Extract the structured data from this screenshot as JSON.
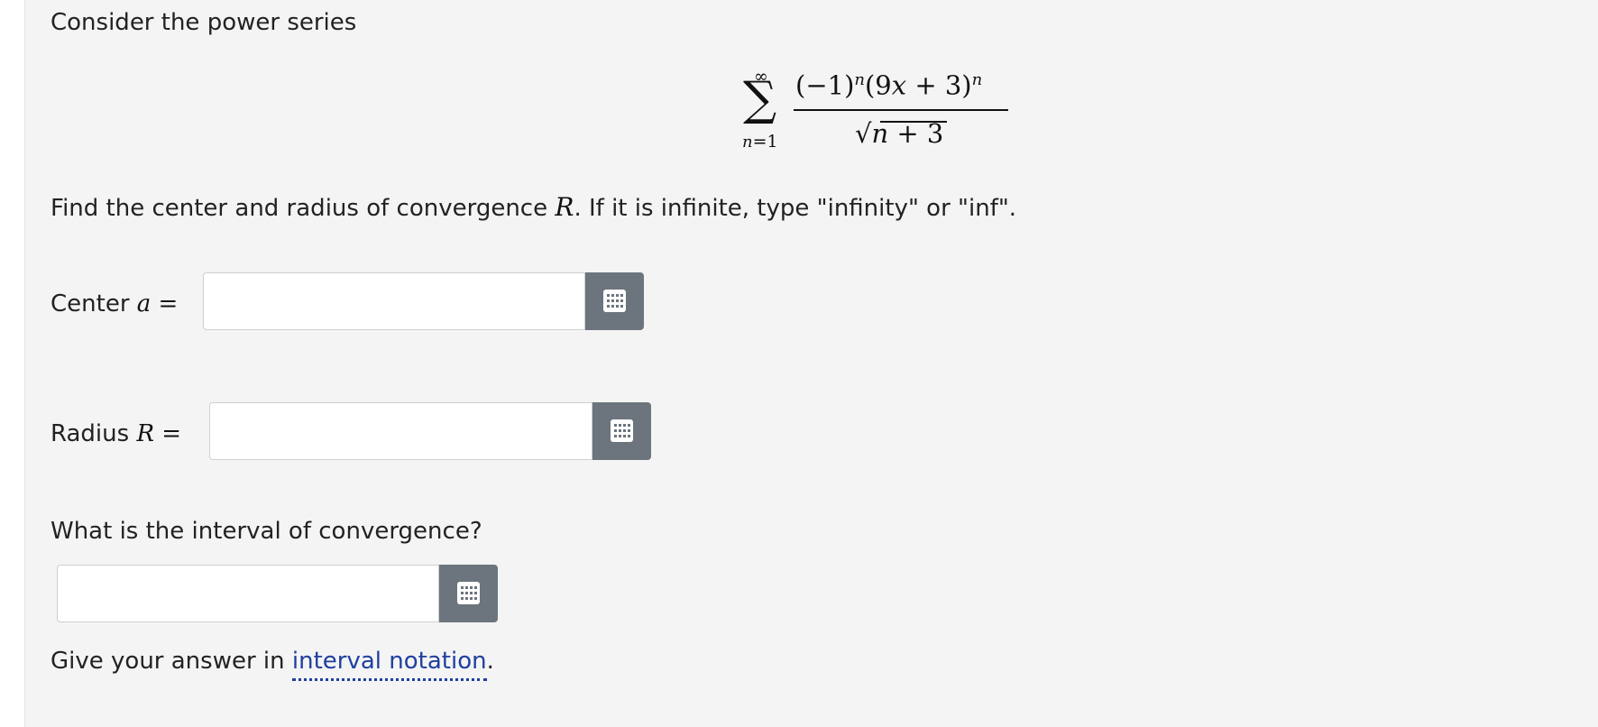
{
  "question": {
    "intro": "Consider the power series",
    "formula": {
      "sum_upper": "∞",
      "sum_lower_var": "n",
      "sum_lower_rest": "=1",
      "numerator": "(−1)",
      "numerator_exp1": "n",
      "numerator_mid": "(9",
      "numerator_var": "x",
      "numerator_tail": " + 3)",
      "numerator_exp2": "n",
      "denominator_var": "n",
      "denominator_tail": " + 3"
    },
    "instruction_pre": "Find the center and radius of convergence ",
    "instruction_var": "R",
    "instruction_post": ". If it is infinite, type \"infinity\" or \"inf\"."
  },
  "center": {
    "label_text": "Center ",
    "label_var": "a",
    "label_eq": " =",
    "value": ""
  },
  "radius": {
    "label_text": "Radius ",
    "label_var": "R",
    "label_eq": " =",
    "value": ""
  },
  "interval": {
    "prompt": "What is the interval of convergence?",
    "value": "",
    "hint_pre": "Give your answer in ",
    "hint_link": "interval notation",
    "hint_post": "."
  },
  "icons": {
    "keyboard": "keyboard-icon"
  },
  "colors": {
    "panel_bg": "#f4f4f4",
    "button_bg": "#6c757d",
    "link": "#1f3fa0"
  }
}
